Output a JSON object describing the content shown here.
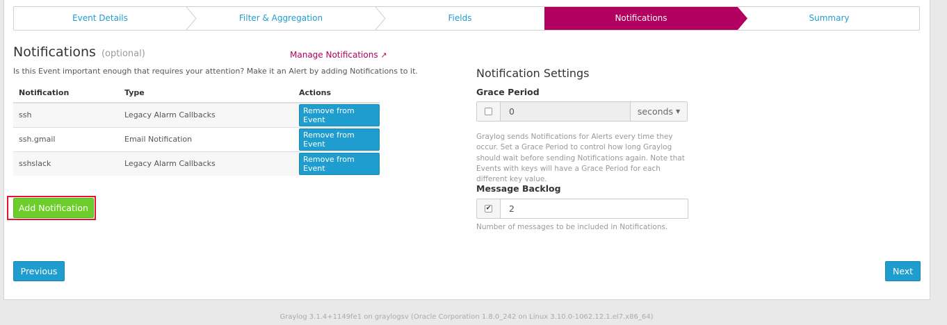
{
  "steps": [
    {
      "label": "Event Details",
      "active": false
    },
    {
      "label": "Filter & Aggregation",
      "active": false
    },
    {
      "label": "Fields",
      "active": false
    },
    {
      "label": "Notifications",
      "active": true
    },
    {
      "label": "Summary",
      "active": false
    }
  ],
  "notifications": {
    "title": "Notifications",
    "optional": "(optional)",
    "manage_link": "Manage Notifications",
    "help": "Is this Event important enough that requires your attention? Make it an Alert by adding Notifications to it.",
    "columns": [
      "Notification",
      "Type",
      "Actions"
    ],
    "rows": [
      {
        "name": "ssh",
        "type": "Legacy Alarm Callbacks",
        "action": "Remove from Event"
      },
      {
        "name": "ssh.gmail",
        "type": "Email Notification",
        "action": "Remove from Event"
      },
      {
        "name": "sshslack",
        "type": "Legacy Alarm Callbacks",
        "action": "Remove from Event"
      }
    ],
    "add_button": "Add Notification"
  },
  "settings": {
    "title": "Notification Settings",
    "grace_label": "Grace Period",
    "grace_checked": false,
    "grace_value": "0",
    "grace_unit": "seconds",
    "grace_help": "Graylog sends Notifications for Alerts every time they occur. Set a Grace Period to control how long Graylog should wait before sending Notifications again. Note that Events with keys will have a Grace Period for each different key value.",
    "backlog_label": "Message Backlog",
    "backlog_checked": true,
    "backlog_value": "2",
    "backlog_help": "Number of messages to be included in Notifications."
  },
  "nav": {
    "previous": "Previous",
    "next": "Next"
  },
  "footer": "Graylog 3.1.4+1149fe1 on graylogsv (Oracle Corporation 1.8.0_242 on Linux 3.10.0-1062.12.1.el7.x86_64)",
  "colors": {
    "accent": "#b1005f",
    "primary": "#1f9dcf",
    "success": "#6ccd2b",
    "highlight": "#e0152b"
  }
}
